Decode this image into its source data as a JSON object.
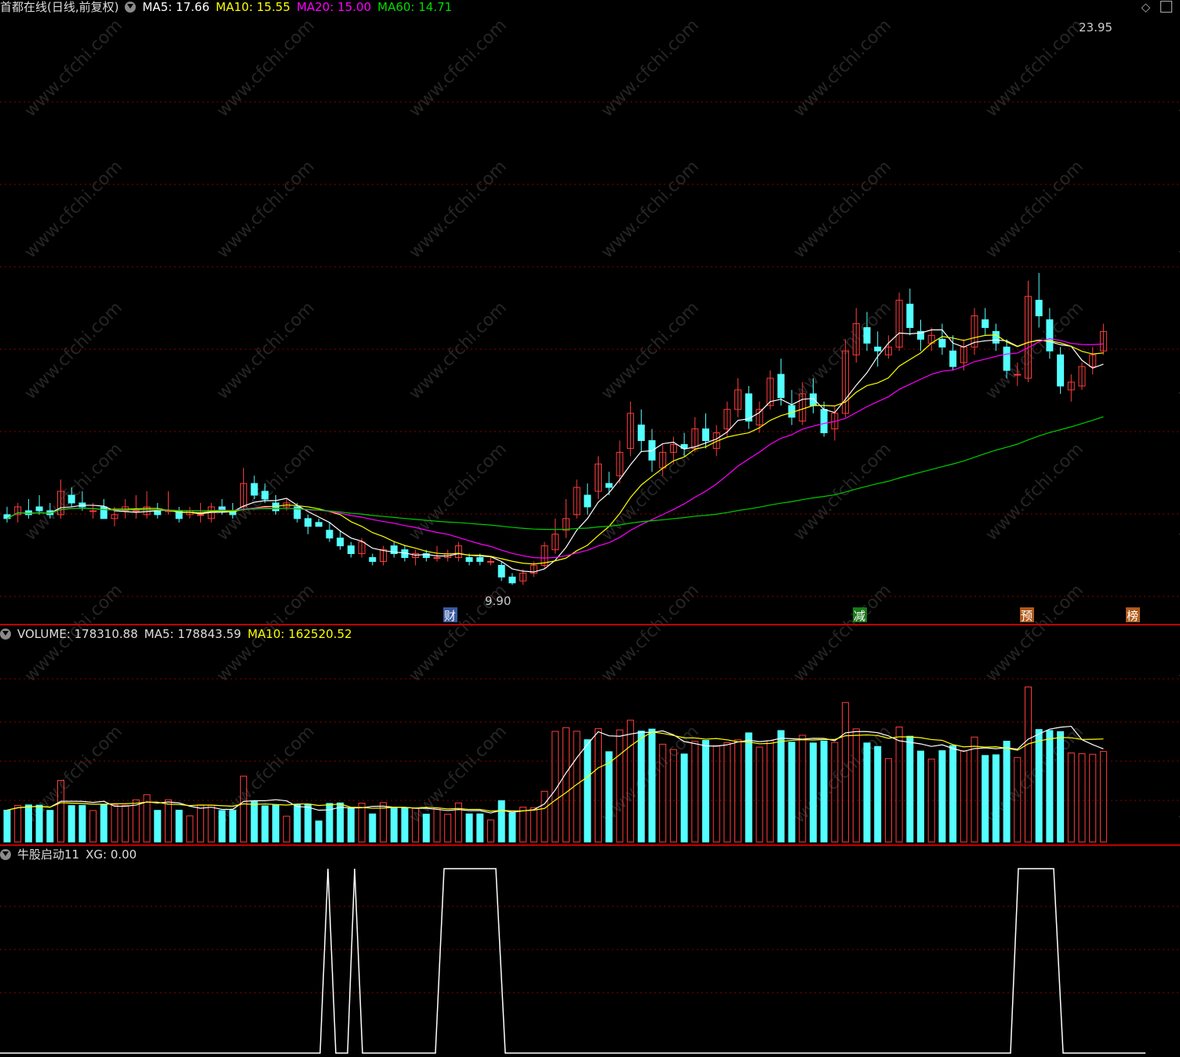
{
  "header": {
    "stock_title": "首都在线(日线,前复权)",
    "ma5": "MA5: 17.66",
    "ma10": "MA10: 15.55",
    "ma20": "MA20: 15.00",
    "ma60": "MA60: 14.71"
  },
  "volume_header": {
    "volume": "VOLUME: 178310.88",
    "ma5": "MA5: 178843.59",
    "ma10": "MA10: 162520.52"
  },
  "indicator_header": {
    "name": "牛股启动11",
    "xg": "XG: 0.00"
  },
  "annotations": {
    "high_label": "23.95",
    "low_label": "9.90"
  },
  "event_markers": [
    {
      "text": "财",
      "bg": "#3a5aa0",
      "fg": "#ffffff"
    },
    {
      "text": "减",
      "bg": "#1a7a1a",
      "fg": "#ffffff"
    },
    {
      "text": "预",
      "bg": "#b05a1a",
      "fg": "#ffffff"
    },
    {
      "text": "榜",
      "bg": "#b05a1a",
      "fg": "#ffffff"
    }
  ],
  "watermark": "www.cfchi.com",
  "colors": {
    "up": "#ff3b3b",
    "down": "#54ffff",
    "ma5": "#ffffff",
    "ma10": "#ffff00",
    "ma20": "#ff00ff",
    "ma60": "#00cc00",
    "grid": "#8b0000",
    "divider": "#c00000"
  },
  "chart_data": [
    {
      "type": "candlestick",
      "title": "首都在线(日线,前复权)",
      "series_names": [
        "MA5",
        "MA10",
        "MA20",
        "MA60"
      ],
      "ohlc_count": 103,
      "ohlc": [
        [
          11.7,
          11.9,
          11.5,
          11.6
        ],
        [
          11.7,
          12.0,
          11.5,
          11.9
        ],
        [
          11.8,
          12.1,
          11.6,
          11.7
        ],
        [
          11.9,
          12.2,
          11.7,
          11.8
        ],
        [
          11.8,
          12.0,
          11.6,
          11.7
        ],
        [
          11.7,
          12.6,
          11.6,
          12.3
        ],
        [
          12.2,
          12.4,
          11.9,
          12.0
        ],
        [
          12.0,
          12.3,
          11.8,
          11.9
        ],
        [
          11.8,
          12.0,
          11.6,
          11.8
        ],
        [
          11.9,
          12.1,
          11.6,
          11.6
        ],
        [
          11.6,
          11.9,
          11.4,
          11.7
        ],
        [
          11.8,
          12.1,
          11.6,
          11.9
        ],
        [
          11.8,
          12.2,
          11.6,
          11.8
        ],
        [
          11.7,
          12.3,
          11.6,
          11.9
        ],
        [
          11.8,
          12.0,
          11.6,
          11.7
        ],
        [
          11.8,
          12.3,
          11.7,
          11.8
        ],
        [
          11.8,
          11.9,
          11.5,
          11.6
        ],
        [
          11.7,
          11.9,
          11.6,
          11.8
        ],
        [
          11.7,
          12.0,
          11.5,
          11.7
        ],
        [
          11.6,
          12.0,
          11.5,
          11.9
        ],
        [
          11.9,
          12.1,
          11.7,
          11.8
        ],
        [
          11.8,
          12.0,
          11.6,
          11.7
        ],
        [
          11.9,
          12.9,
          11.8,
          12.5
        ],
        [
          12.5,
          12.7,
          12.1,
          12.2
        ],
        [
          12.3,
          12.5,
          12.0,
          12.1
        ],
        [
          12.0,
          12.2,
          11.7,
          11.8
        ],
        [
          11.9,
          12.1,
          11.8,
          12.0
        ],
        [
          11.9,
          12.0,
          11.5,
          11.6
        ],
        [
          11.6,
          11.7,
          11.2,
          11.4
        ],
        [
          11.5,
          11.6,
          11.4,
          11.4
        ],
        [
          11.3,
          11.5,
          11.0,
          11.1
        ],
        [
          11.1,
          11.3,
          10.8,
          10.9
        ],
        [
          10.9,
          11.0,
          10.6,
          10.7
        ],
        [
          10.7,
          11.1,
          10.6,
          11.0
        ],
        [
          10.6,
          10.7,
          10.4,
          10.5
        ],
        [
          10.5,
          10.9,
          10.4,
          10.8
        ],
        [
          10.9,
          11.0,
          10.6,
          10.7
        ],
        [
          10.8,
          10.9,
          10.5,
          10.6
        ],
        [
          10.6,
          10.8,
          10.4,
          10.7
        ],
        [
          10.7,
          10.8,
          10.5,
          10.6
        ],
        [
          10.6,
          10.9,
          10.5,
          10.6
        ],
        [
          10.6,
          10.8,
          10.5,
          10.7
        ],
        [
          10.6,
          11.0,
          10.5,
          10.9
        ],
        [
          10.6,
          10.7,
          10.4,
          10.5
        ],
        [
          10.6,
          10.7,
          10.4,
          10.5
        ],
        [
          10.5,
          10.6,
          10.4,
          10.5
        ],
        [
          10.4,
          10.5,
          10.0,
          10.1
        ],
        [
          10.1,
          10.2,
          9.9,
          9.95
        ],
        [
          10.0,
          10.3,
          9.9,
          10.2
        ],
        [
          10.2,
          10.5,
          10.1,
          10.4
        ],
        [
          10.4,
          11.0,
          10.3,
          10.9
        ],
        [
          10.8,
          11.6,
          10.7,
          11.2
        ],
        [
          11.3,
          12.1,
          11.1,
          11.6
        ],
        [
          11.7,
          12.6,
          11.6,
          12.4
        ],
        [
          12.2,
          12.5,
          11.7,
          11.9
        ],
        [
          12.3,
          13.2,
          12.1,
          13.0
        ],
        [
          12.5,
          12.8,
          12.2,
          12.4
        ],
        [
          12.7,
          13.6,
          12.5,
          13.3
        ],
        [
          13.4,
          14.6,
          13.2,
          14.3
        ],
        [
          14.0,
          14.4,
          13.3,
          13.6
        ],
        [
          13.6,
          13.9,
          12.8,
          13.1
        ],
        [
          12.9,
          13.5,
          12.7,
          13.3
        ],
        [
          13.3,
          13.7,
          13.0,
          13.5
        ],
        [
          13.5,
          13.8,
          13.2,
          13.4
        ],
        [
          13.4,
          14.2,
          13.3,
          13.9
        ],
        [
          13.9,
          14.3,
          13.4,
          13.6
        ],
        [
          13.4,
          14.0,
          13.2,
          13.8
        ],
        [
          13.9,
          14.6,
          13.7,
          14.4
        ],
        [
          14.4,
          15.2,
          14.2,
          14.9
        ],
        [
          14.8,
          15.0,
          13.9,
          14.1
        ],
        [
          14.0,
          14.6,
          13.8,
          14.4
        ],
        [
          14.5,
          15.4,
          14.4,
          15.2
        ],
        [
          15.3,
          15.7,
          14.5,
          14.7
        ],
        [
          14.5,
          14.9,
          14.0,
          14.2
        ],
        [
          14.1,
          15.1,
          14.0,
          14.8
        ],
        [
          14.8,
          15.2,
          14.3,
          14.5
        ],
        [
          14.4,
          14.6,
          13.7,
          13.8
        ],
        [
          13.9,
          14.5,
          13.6,
          14.3
        ],
        [
          14.3,
          16.2,
          14.2,
          15.9
        ],
        [
          15.8,
          17.0,
          15.6,
          16.6
        ],
        [
          16.5,
          16.9,
          15.9,
          16.1
        ],
        [
          16.0,
          16.4,
          15.5,
          15.9
        ],
        [
          15.8,
          16.3,
          15.7,
          16.0
        ],
        [
          16.0,
          17.4,
          15.9,
          17.2
        ],
        [
          17.1,
          17.5,
          16.3,
          16.5
        ],
        [
          16.4,
          16.7,
          15.9,
          16.2
        ],
        [
          16.1,
          16.5,
          15.9,
          16.3
        ],
        [
          16.2,
          16.6,
          15.8,
          16.0
        ],
        [
          15.9,
          16.3,
          15.4,
          15.5
        ],
        [
          15.6,
          16.2,
          15.4,
          16.0
        ],
        [
          16.0,
          17.0,
          15.8,
          16.8
        ],
        [
          16.7,
          17.0,
          16.3,
          16.5
        ],
        [
          16.4,
          16.6,
          15.9,
          16.1
        ],
        [
          16.0,
          16.2,
          15.2,
          15.4
        ],
        [
          15.3,
          15.6,
          15.0,
          15.3
        ],
        [
          15.2,
          17.7,
          15.1,
          17.3
        ],
        [
          17.2,
          17.9,
          16.5,
          16.8
        ],
        [
          16.7,
          17.0,
          15.7,
          15.9
        ],
        [
          15.8,
          16.0,
          14.8,
          15.0
        ],
        [
          14.9,
          15.3,
          14.6,
          15.1
        ],
        [
          15.0,
          15.6,
          14.9,
          15.5
        ],
        [
          15.5,
          16.0,
          15.3,
          15.8
        ],
        [
          15.9,
          16.6,
          15.8,
          16.4
        ]
      ],
      "ylim": [
        9.0,
        24.5
      ],
      "max_label": 23.95,
      "min_label": 9.9
    },
    {
      "type": "bar",
      "title": "VOLUME",
      "series": [
        {
          "name": "VOLUME"
        },
        {
          "name": "MA5"
        },
        {
          "name": "MA10"
        }
      ],
      "latest": {
        "VOLUME": 178310.88,
        "MA5": 178843.59,
        "MA10": 162520.52
      }
    },
    {
      "type": "line",
      "title": "牛股启动11",
      "series": [
        {
          "name": "XG",
          "latest": 0.0
        }
      ]
    }
  ]
}
